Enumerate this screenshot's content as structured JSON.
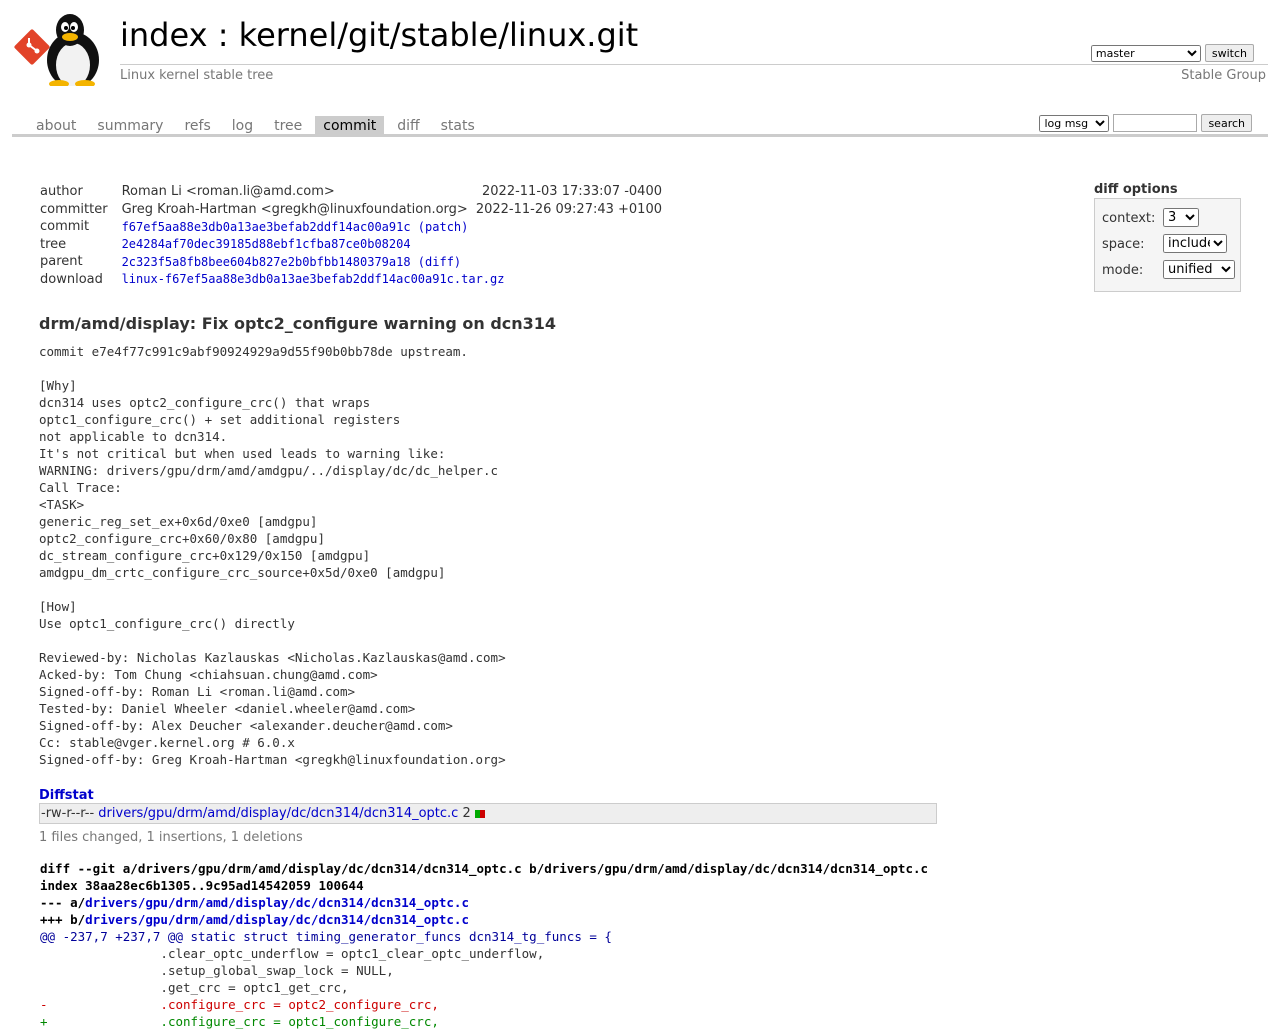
{
  "header": {
    "title_index": "index",
    "title_sep": " : ",
    "title_repo": "kernel/git/stable/linux.git",
    "description": "Linux kernel stable tree",
    "owner": "Stable Group",
    "branch_selected": "master",
    "switch_label": "switch"
  },
  "tabs": [
    {
      "label": "about"
    },
    {
      "label": "summary"
    },
    {
      "label": "refs"
    },
    {
      "label": "log"
    },
    {
      "label": "tree"
    },
    {
      "label": "commit",
      "active": true
    },
    {
      "label": "diff"
    },
    {
      "label": "stats"
    }
  ],
  "search": {
    "mode_selected": "log msg",
    "query": "",
    "button_label": "search"
  },
  "commit_info": {
    "author_label": "author",
    "author": "Roman Li <roman.li@amd.com>",
    "author_date": "2022-11-03 17:33:07 -0400",
    "committer_label": "committer",
    "committer": "Greg Kroah-Hartman <gregkh@linuxfoundation.org>",
    "committer_date": "2022-11-26 09:27:43 +0100",
    "commit_label": "commit",
    "commit_hash": "f67ef5aa88e3db0a13ae3befab2ddf14ac00a91c",
    "commit_link": "(patch)",
    "tree_label": "tree",
    "tree_hash": "2e4284af70dec39185d88ebf1cfba87ce0b08204",
    "parent_label": "parent",
    "parent_hash": "2c323f5a8fb8bee604b827e2b0bfbb1480379a18",
    "parent_link": "(diff)",
    "download_label": "download",
    "download_file": "linux-f67ef5aa88e3db0a13ae3befab2ddf14ac00a91c.tar.gz"
  },
  "diff_options": {
    "title": "diff options",
    "context_label": "context:",
    "context_value": "3",
    "space_label": "space:",
    "space_value": "include",
    "mode_label": "mode:",
    "mode_value": "unified"
  },
  "subject": "drm/amd/display: Fix optc2_configure warning on dcn314",
  "message": "commit e7e4f77c991c9abf90924929a9d55f90b0bb78de upstream.\n\n[Why]\ndcn314 uses optc2_configure_crc() that wraps\noptc1_configure_crc() + set additional registers\nnot applicable to dcn314.\nIt's not critical but when used leads to warning like:\nWARNING: drivers/gpu/drm/amd/amdgpu/../display/dc/dc_helper.c\nCall Trace:\n<TASK>\ngeneric_reg_set_ex+0x6d/0xe0 [amdgpu]\noptc2_configure_crc+0x60/0x80 [amdgpu]\ndc_stream_configure_crc+0x129/0x150 [amdgpu]\namdgpu_dm_crtc_configure_crc_source+0x5d/0xe0 [amdgpu]\n\n[How]\nUse optc1_configure_crc() directly\n\nReviewed-by: Nicholas Kazlauskas <Nicholas.Kazlauskas@amd.com>\nAcked-by: Tom Chung <chiahsuan.chung@amd.com>\nSigned-off-by: Roman Li <roman.li@amd.com>\nTested-by: Daniel Wheeler <daniel.wheeler@amd.com>\nSigned-off-by: Alex Deucher <alexander.deucher@amd.com>\nCc: stable@vger.kernel.org # 6.0.x\nSigned-off-by: Greg Kroah-Hartman <gregkh@linuxfoundation.org>",
  "diffstat": {
    "header": "Diffstat",
    "mode": "-rw-r--r--",
    "file": "drivers/gpu/drm/amd/display/dc/dcn314/dcn314_optc.c",
    "count": "2",
    "insertions": 1,
    "deletions": 1,
    "summary": "1 files changed, 1 insertions, 1 deletions",
    "add_color": "#00aa00",
    "del_color": "#cc0000"
  },
  "diff": {
    "git_line_a": "diff --git a/drivers/gpu/drm/amd/display/dc/dcn314/dcn314_optc.c b/drivers/gpu/drm/amd/display/dc/dcn314/dcn314_optc.c",
    "index_line": "index 38aa28ec6b1305..9c95ad14542059 100644",
    "minus_prefix": "--- a/",
    "minus_file": "drivers/gpu/drm/amd/display/dc/dcn314/dcn314_optc.c",
    "plus_prefix": "+++ b/",
    "plus_file": "drivers/gpu/drm/amd/display/dc/dcn314/dcn314_optc.c",
    "hunk": "@@ -237,7 +237,7 @@ static struct timing_generator_funcs dcn314_tg_funcs = {",
    "ctx1": " \t\t.clear_optc_underflow = optc1_clear_optc_underflow,",
    "ctx2": " \t\t.setup_global_swap_lock = NULL,",
    "ctx3": " \t\t.get_crc = optc1_get_crc,",
    "del1": "-\t\t.configure_crc = optc2_configure_crc,",
    "add1": "+\t\t.configure_crc = optc1_configure_crc,"
  }
}
